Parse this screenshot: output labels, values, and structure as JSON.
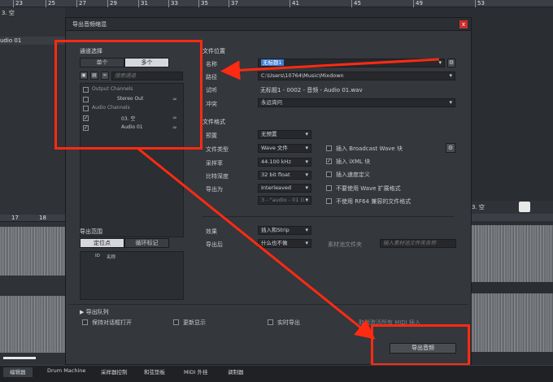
{
  "ruler": {
    "marks": [
      "23",
      "25",
      "27",
      "29",
      "31",
      "33",
      "35",
      "37",
      "41",
      "45",
      "49",
      "53"
    ]
  },
  "bg": {
    "track_name": "3. 空",
    "track_audio": "udio 01",
    "right_track": "3. 空",
    "ruler2": [
      "17",
      "18"
    ]
  },
  "dialog": {
    "title": "导出音频缩混",
    "close": "x",
    "channel_select": {
      "title": "通道选择",
      "tab_single": "单个",
      "tab_multi": "多个",
      "search_placeholder": "搜索通道",
      "tree": [
        {
          "label": "Output Channels",
          "checked": false
        },
        {
          "label": "Stereo Out",
          "checked": false
        },
        {
          "label": "Audio Channels",
          "checked": false
        },
        {
          "label": "03. 空",
          "checked": true
        },
        {
          "label": "Audio 01",
          "checked": true
        }
      ]
    },
    "export_range": {
      "title": "导出范围",
      "tab_locators": "定位点",
      "tab_cycle": "循环标记",
      "col_id": "ID",
      "col_name": "名称"
    },
    "file_location": {
      "title": "文件位置",
      "name_label": "名称",
      "name_value": "无标题1",
      "path_label": "路径",
      "path_value": "C:\\Users\\10764\\Music\\Mixdown",
      "preview_label": "试听",
      "preview_value": "无标题1 - 0002 - 音频 - Audio 01.wav",
      "conflict_label": "冲突",
      "conflict_value": "永远询问"
    },
    "file_format": {
      "title": "文件格式",
      "preset_label": "预置",
      "preset_value": "无预置",
      "type_label": "文件类型",
      "type_value": "Wave 文件",
      "rate_label": "采样率",
      "rate_value": "44.100 kHz",
      "depth_label": "比特深度",
      "depth_value": "32 bit float",
      "export_as_label": "导出为",
      "export_as_value": "Interleaved",
      "channels_value": "3 - \"audio - 01 (I...",
      "bwf": "插入 Broadcast Wave 块",
      "ixml": "插入 iXML 块",
      "tempo": "插入速度定义",
      "no_ext": "不要使用 Wave 扩展格式",
      "no_rf64": "不使用 RF64 兼容的文件格式"
    },
    "after": {
      "effects_label": "效果",
      "effects_value": "插入和Strip",
      "after_label": "导出后",
      "after_value": "什么也不做",
      "pool_label": "素材池文件夹",
      "pool_placeholder": "输入素材池文件夹名称"
    },
    "queue": {
      "title": "导出队列",
      "keep_open": "保持对话框打开",
      "update_display": "更新显示",
      "realtime": "实时导出",
      "midi_note": "取消激活所有 MIDI 插入",
      "export_button": "导出音频"
    }
  },
  "bottom_tabs": [
    "编辑器",
    "Drum Machine",
    "采样器控制",
    "和弦垫板",
    "MIDI 外挂",
    "调制器"
  ],
  "colors": {
    "accent": "#3e7fd6",
    "annotation": "#ff2a12"
  }
}
